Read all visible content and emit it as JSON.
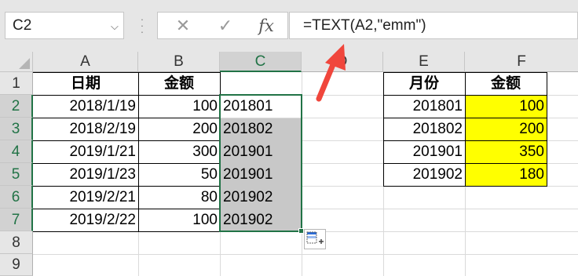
{
  "formula_bar": {
    "name_box": "C2",
    "name_box_arrow": "⌵",
    "cancel_icon": "✕",
    "enter_icon": "✓",
    "fx_label": "fx",
    "formula": "=TEXT(A2,\"emm\")"
  },
  "columns": [
    "A",
    "B",
    "C",
    "D",
    "E",
    "F"
  ],
  "rows": [
    "1",
    "2",
    "3",
    "4",
    "5",
    "6",
    "7",
    "8",
    "9"
  ],
  "table_left": {
    "headers": [
      "日期",
      "金额"
    ],
    "rows": [
      [
        "2018/1/19",
        "100",
        "201801"
      ],
      [
        "2018/2/19",
        "200",
        "201802"
      ],
      [
        "2019/1/21",
        "300",
        "201901"
      ],
      [
        "2019/1/23",
        "50",
        "201901"
      ],
      [
        "2019/2/21",
        "80",
        "201902"
      ],
      [
        "2019/2/22",
        "100",
        "201902"
      ]
    ]
  },
  "table_right": {
    "headers": [
      "月份",
      "金额"
    ],
    "rows": [
      [
        "201801",
        "100"
      ],
      [
        "201802",
        "200"
      ],
      [
        "201901",
        "350"
      ],
      [
        "201902",
        "180"
      ]
    ]
  },
  "colors": {
    "selection": "#217346",
    "highlight_yellow": "#ffff00",
    "selected_fill": "#c8c8c8",
    "arrow": "#f0463c"
  }
}
